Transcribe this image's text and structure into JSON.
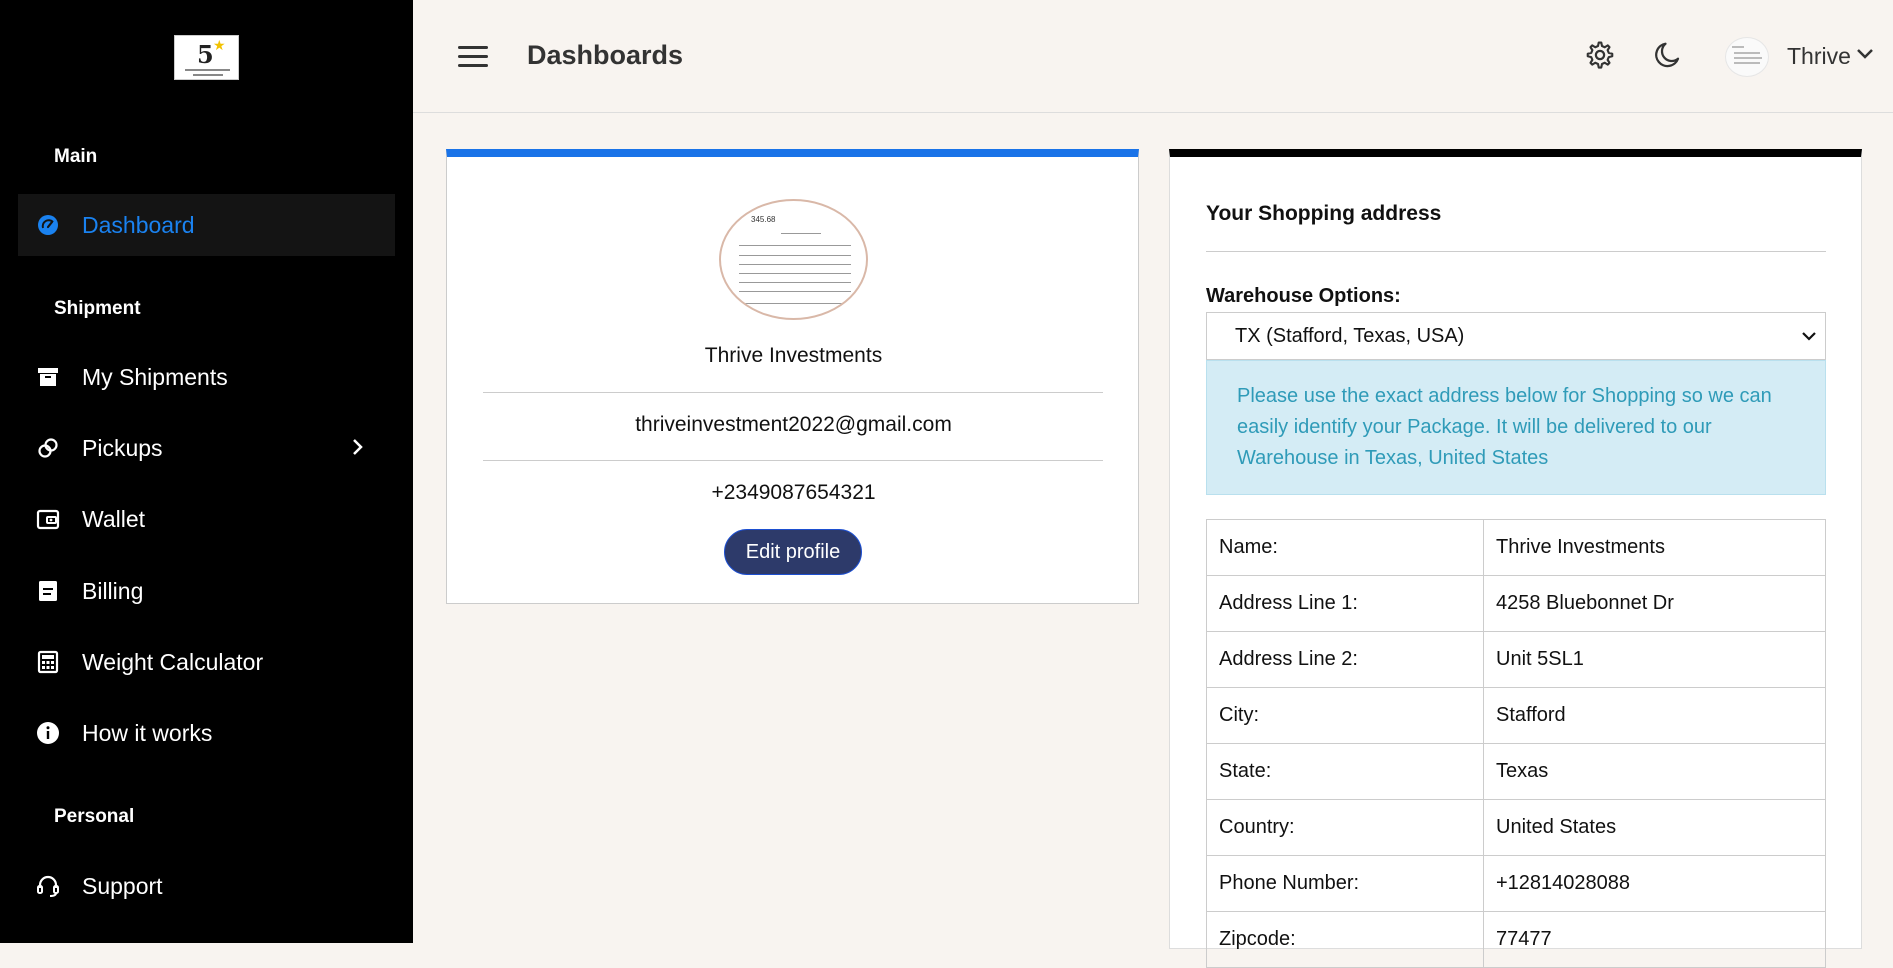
{
  "sidebar": {
    "logo": {
      "text": "5"
    },
    "sections": [
      {
        "label": "Main"
      },
      {
        "label": "Shipment"
      },
      {
        "label": "Personal"
      }
    ],
    "items": [
      {
        "label": "Dashboard",
        "icon": "dashboard-gauge-icon",
        "active": true
      },
      {
        "label": "My Shipments",
        "icon": "archive-box-icon"
      },
      {
        "label": "Pickups",
        "icon": "link-icon",
        "has_submenu": true
      },
      {
        "label": "Wallet",
        "icon": "wallet-icon"
      },
      {
        "label": "Billing",
        "icon": "document-icon"
      },
      {
        "label": "Weight Calculator",
        "icon": "calculator-icon"
      },
      {
        "label": "How it works",
        "icon": "info-icon"
      },
      {
        "label": "Support",
        "icon": "headset-icon"
      }
    ]
  },
  "topbar": {
    "title": "Dashboards",
    "user_name": "Thrive"
  },
  "profile": {
    "avatar_amount": "345.68",
    "name": "Thrive Investments",
    "email": "thriveinvestment2022@gmail.com",
    "phone": "+2349087654321",
    "edit_label": "Edit profile"
  },
  "address": {
    "title": "Your Shopping address",
    "warehouse_label": "Warehouse Options:",
    "warehouse_selected": "TX (Stafford, Texas, USA)",
    "info_text": "Please use the exact address below for Shopping so we can easily identify your Package. It will be delivered to our Warehouse in Texas, United States",
    "rows": [
      {
        "key": "Name:",
        "value": "Thrive Investments"
      },
      {
        "key": "Address Line 1:",
        "value": "4258 Bluebonnet Dr"
      },
      {
        "key": "Address Line 2:",
        "value": "Unit 5SL1"
      },
      {
        "key": "City:",
        "value": "Stafford"
      },
      {
        "key": "State:",
        "value": "Texas"
      },
      {
        "key": "Country:",
        "value": "United States"
      },
      {
        "key": "Phone Number:",
        "value": "+12814028088"
      },
      {
        "key": "Zipcode:",
        "value": "77477"
      }
    ]
  },
  "colors": {
    "sidebar_bg": "#000000",
    "active_accent": "#1a82f0",
    "profile_top_border": "#1a73e8",
    "button_bg": "#2d3a6a",
    "info_bg": "#d4ecf5",
    "info_text": "#2f9bb8"
  }
}
